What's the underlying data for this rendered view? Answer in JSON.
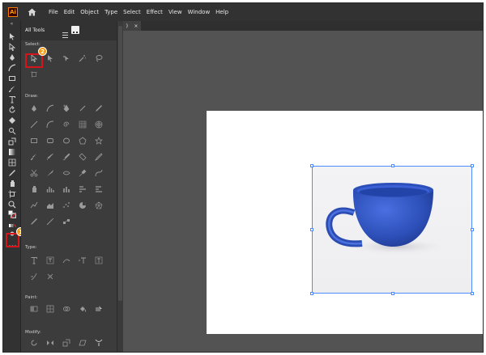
{
  "app": {
    "logo_text": "Ai",
    "accent": "#ff9a00"
  },
  "menubar": {
    "items": [
      "File",
      "Edit",
      "Object",
      "Type",
      "Select",
      "Effect",
      "View",
      "Window",
      "Help"
    ]
  },
  "toolbar": {
    "collapse_glyph": "«"
  },
  "panel": {
    "title": "All Tools",
    "sections": {
      "select": "Select:",
      "draw": "Draw:",
      "type": "Type:",
      "paint": "Paint:",
      "modify": "Modify:"
    }
  },
  "doc_tab": {
    "close_label": "×",
    "left_glyph": ")"
  },
  "annotations": {
    "step1": "1",
    "step2": "2",
    "highlight_color": "#d7141a",
    "badge_color": "#f39c12"
  },
  "artwork": {
    "subject": "blue-coffee-cup",
    "cup_color": "#2f4fb3"
  }
}
